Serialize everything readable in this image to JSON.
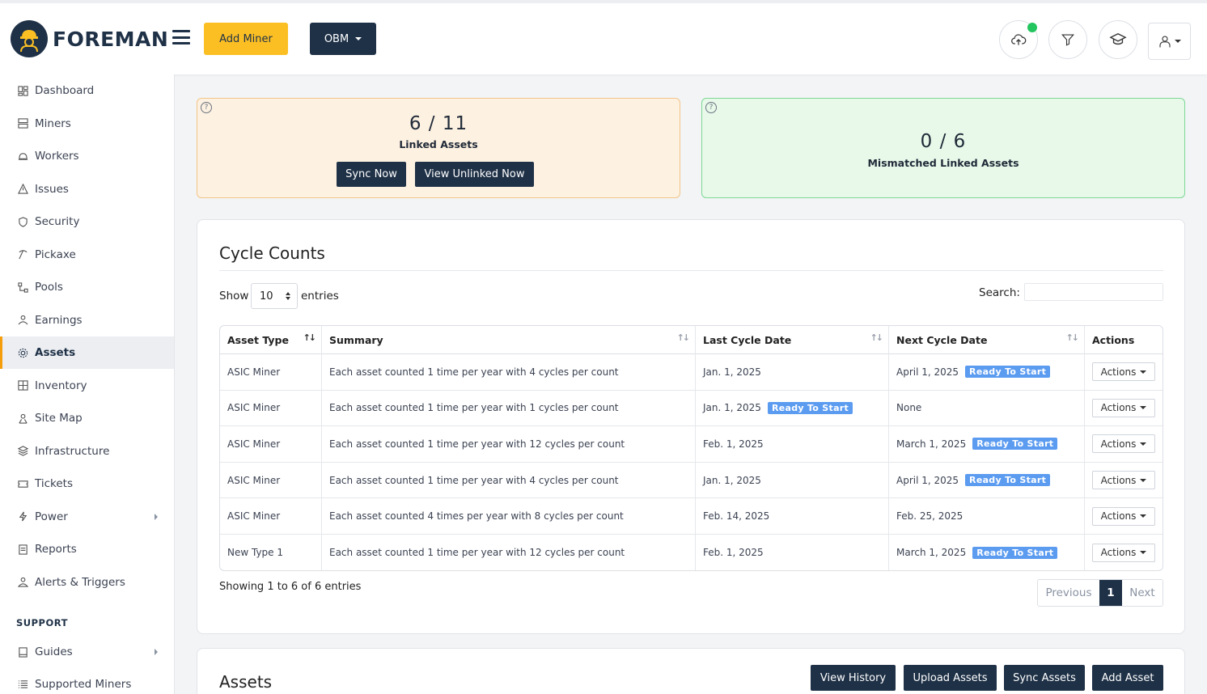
{
  "header": {
    "brand": "FOREMAN",
    "add_miner_label": "Add Miner",
    "obm_label": "OBM",
    "icons": [
      "upload-cloud-icon",
      "filter-icon",
      "graduation-cap-icon",
      "user-icon"
    ],
    "colors": {
      "brand": "#1f3147",
      "accent": "#fbbf24",
      "status": "#22c55e"
    }
  },
  "sidebar": {
    "items": [
      {
        "label": "Dashboard",
        "icon": "dashboard-icon"
      },
      {
        "label": "Miners",
        "icon": "server-icon"
      },
      {
        "label": "Workers",
        "icon": "hardhat-icon"
      },
      {
        "label": "Issues",
        "icon": "warning-icon"
      },
      {
        "label": "Security",
        "icon": "shield-icon"
      },
      {
        "label": "Pickaxe",
        "icon": "pickaxe-icon"
      },
      {
        "label": "Pools",
        "icon": "pools-icon"
      },
      {
        "label": "Earnings",
        "icon": "earnings-icon"
      },
      {
        "label": "Assets",
        "icon": "gear-icon",
        "active": true
      },
      {
        "label": "Inventory",
        "icon": "inventory-icon"
      },
      {
        "label": "Site Map",
        "icon": "sitemap-icon"
      },
      {
        "label": "Infrastructure",
        "icon": "layers-icon"
      },
      {
        "label": "Tickets",
        "icon": "ticket-icon"
      },
      {
        "label": "Power",
        "icon": "lightning-icon",
        "has_submenu": true
      },
      {
        "label": "Reports",
        "icon": "report-icon"
      },
      {
        "label": "Alerts & Triggers",
        "icon": "bell-icon"
      }
    ],
    "support_heading": "SUPPORT",
    "support_items": [
      {
        "label": "Guides",
        "icon": "book-icon",
        "has_submenu": true
      },
      {
        "label": "Supported Miners",
        "icon": "list-icon"
      }
    ]
  },
  "summary": {
    "linked": {
      "count": "6 / 11",
      "label": "Linked Assets",
      "sync_label": "Sync Now",
      "view_unlinked_label": "View Unlinked Now"
    },
    "mismatch": {
      "count": "0 / 6",
      "label": "Mismatched Linked Assets"
    },
    "help_glyph": "?"
  },
  "cycle_counts": {
    "title": "Cycle Counts",
    "show_label": "Show",
    "entries_value": "10",
    "entries_label": "entries",
    "search_label": "Search:",
    "search_value": "",
    "columns": [
      "Asset Type",
      "Summary",
      "Last Cycle Date",
      "Next Cycle Date",
      "Actions"
    ],
    "rows": [
      {
        "asset_type": "ASIC Miner",
        "summary": "Each asset counted 1 time per year with 4 cycles per count",
        "last_date": "Jan. 1, 2025",
        "last_badge": "",
        "next_date": "April 1, 2025",
        "next_badge": "Ready To Start",
        "action": "Actions"
      },
      {
        "asset_type": "ASIC Miner",
        "summary": "Each asset counted 1 time per year with 1 cycles per count",
        "last_date": "Jan. 1, 2025",
        "last_badge": "Ready To Start",
        "next_date": "None",
        "next_badge": "",
        "action": "Actions"
      },
      {
        "asset_type": "ASIC Miner",
        "summary": "Each asset counted 1 time per year with 12 cycles per count",
        "last_date": "Feb. 1, 2025",
        "last_badge": "",
        "next_date": "March 1, 2025",
        "next_badge": "Ready To Start",
        "action": "Actions"
      },
      {
        "asset_type": "ASIC Miner",
        "summary": "Each asset counted 1 time per year with 4 cycles per count",
        "last_date": "Jan. 1, 2025",
        "last_badge": "",
        "next_date": "April 1, 2025",
        "next_badge": "Ready To Start",
        "action": "Actions"
      },
      {
        "asset_type": "ASIC Miner",
        "summary": "Each asset counted 4 times per year with 8 cycles per count",
        "last_date": "Feb. 14, 2025",
        "last_badge": "",
        "next_date": "Feb. 25, 2025",
        "next_badge": "",
        "action": "Actions"
      },
      {
        "asset_type": "New Type 1",
        "summary": "Each asset counted 1 time per year with 12 cycles per count",
        "last_date": "Feb. 1, 2025",
        "last_badge": "",
        "next_date": "March 1, 2025",
        "next_badge": "Ready To Start",
        "action": "Actions"
      }
    ],
    "showing_text": "Showing 1 to 6 of 6 entries",
    "pager": {
      "previous": "Previous",
      "current": "1",
      "next": "Next"
    }
  },
  "assets": {
    "title": "Assets",
    "buttons": [
      "View History",
      "Upload Assets",
      "Sync Assets",
      "Add Asset"
    ]
  }
}
